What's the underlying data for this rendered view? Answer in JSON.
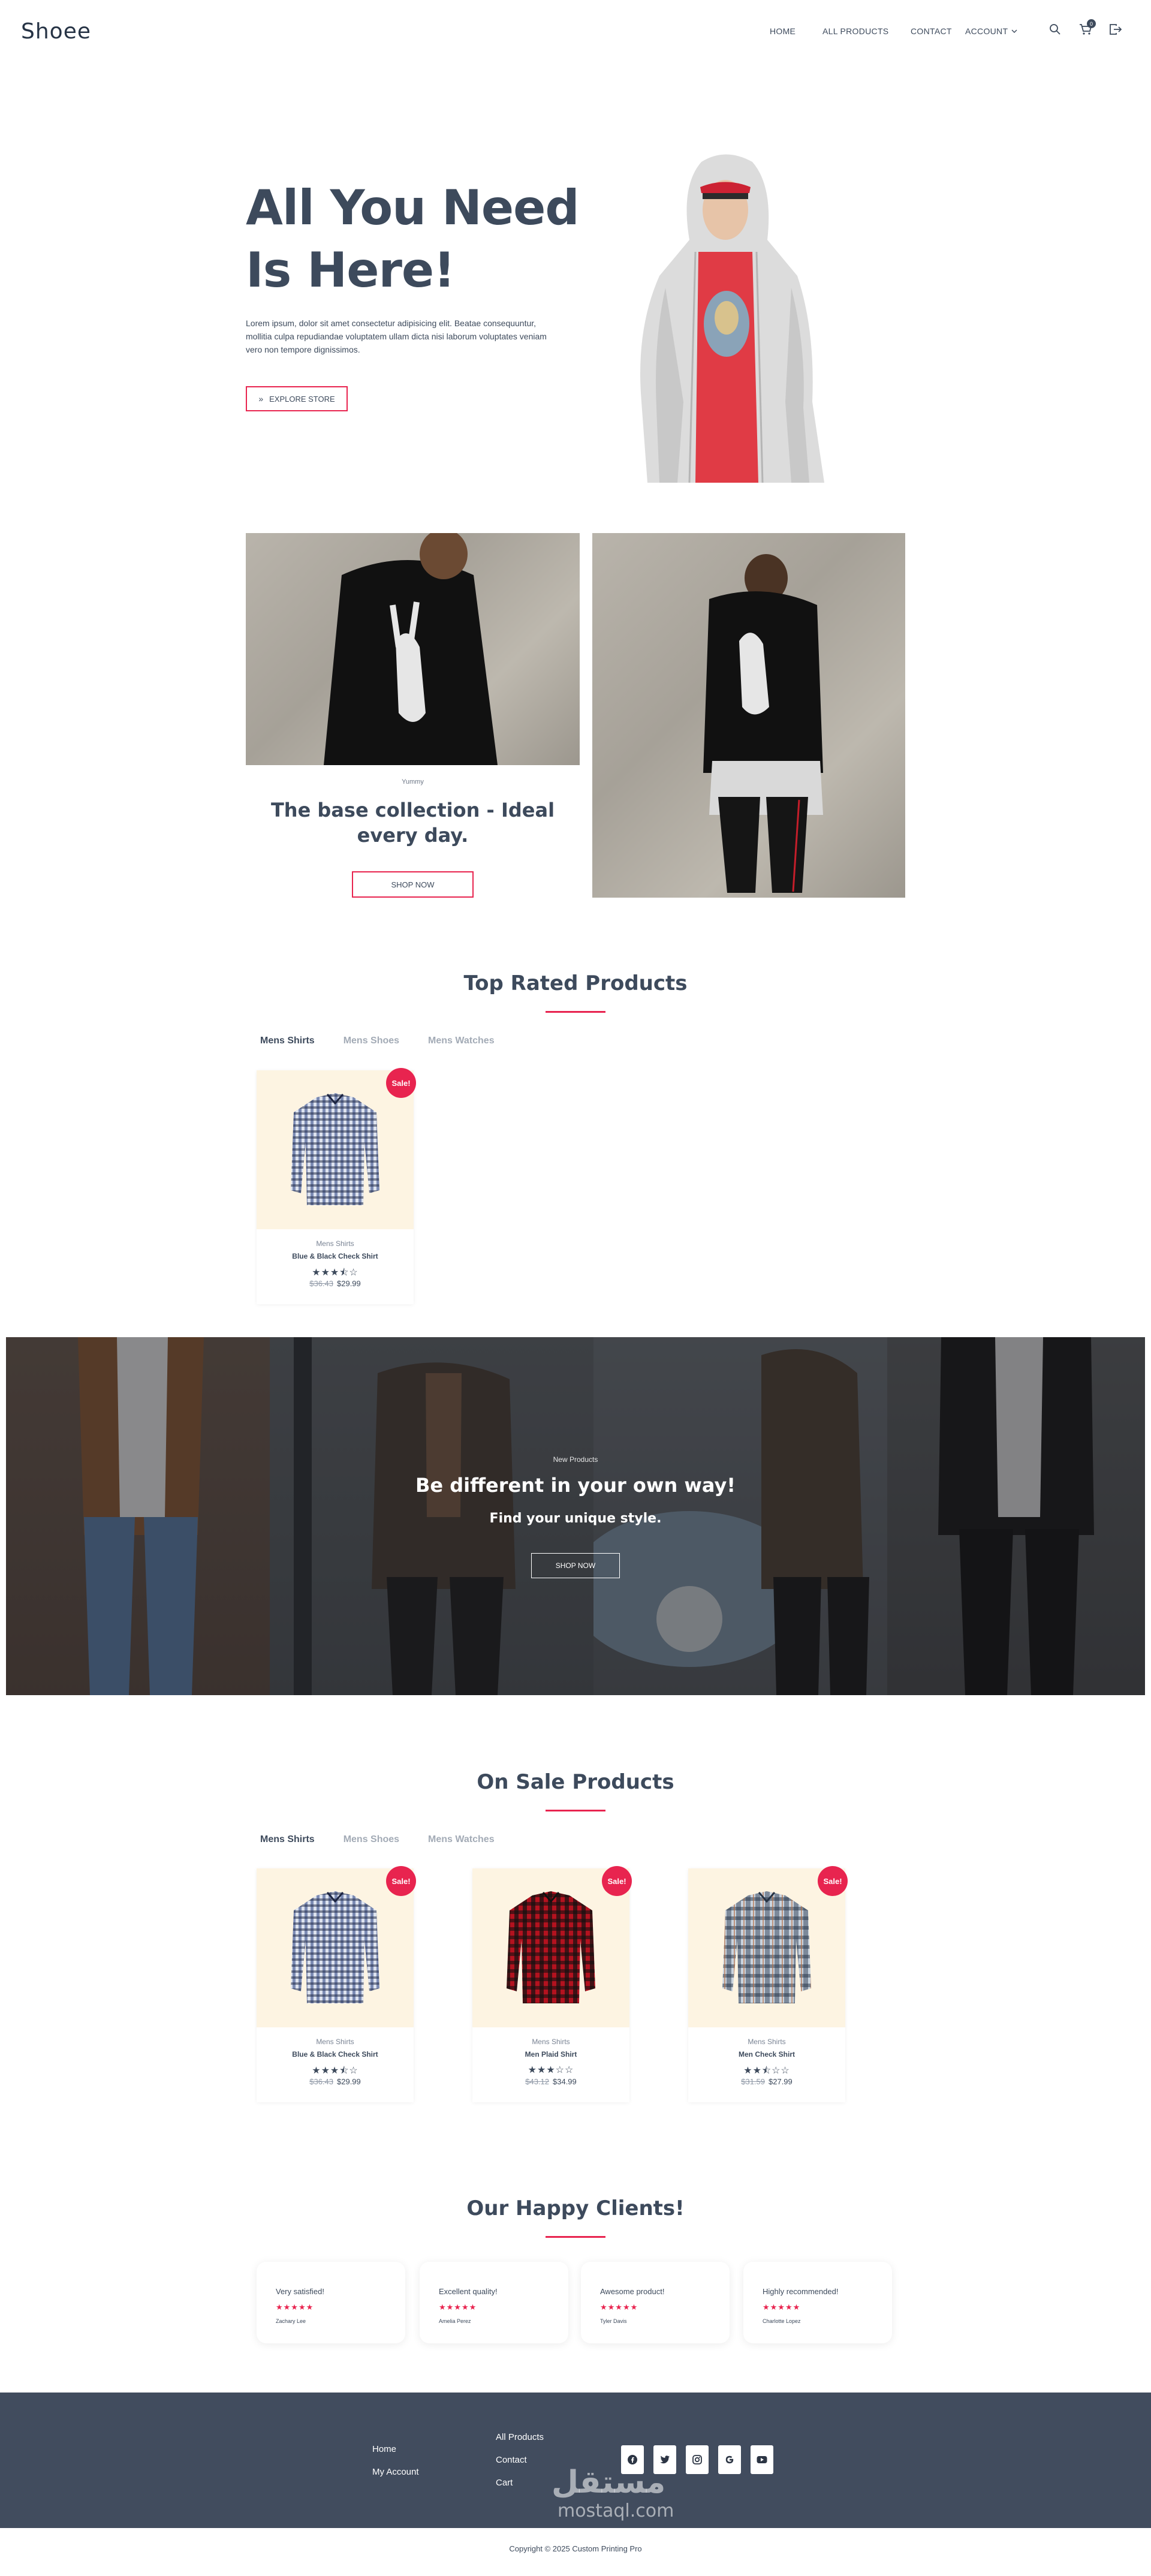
{
  "header": {
    "logo": "Shoee",
    "nav": [
      "HOME",
      "ALL PRODUCTS",
      "CONTACT",
      "ACCOUNT"
    ],
    "cart_count": "0",
    "icons": [
      "search-icon",
      "cart-icon",
      "logout-icon"
    ]
  },
  "hero": {
    "title": "All You Need Is Here!",
    "text": "Lorem ipsum, dolor sit amet consectetur adipisicing elit. Beatae consequuntur, mollitia culpa repudiandae voluptatem ullam dicta nisi laborum voluptates veniam vero non tempore dignissimos.",
    "button": "EXPLORE STORE"
  },
  "base_collection": {
    "tag": "Yummy",
    "title": "The base collection - Ideal every day.",
    "button": "SHOP NOW"
  },
  "top_rated": {
    "title": "Top Rated Products",
    "tabs": [
      "Mens Shirts",
      "Mens Shoes",
      "Mens Watches"
    ],
    "products": [
      {
        "badge": "Sale!",
        "category": "Mens Shirts",
        "name": "Blue & Black Check Shirt",
        "stars": "★★★⯪☆",
        "old_price": "$36.43",
        "price": "$29.99"
      }
    ]
  },
  "banner": {
    "tag": "New Products",
    "title": "Be different in your own way!",
    "subtitle": "Find your unique style.",
    "button": "SHOP NOW"
  },
  "on_sale": {
    "title": "On Sale Products",
    "tabs": [
      "Mens Shirts",
      "Mens Shoes",
      "Mens Watches"
    ],
    "products": [
      {
        "badge": "Sale!",
        "category": "Mens Shirts",
        "name": "Blue & Black Check Shirt",
        "stars": "★★★⯪☆",
        "old_price": "$36.43",
        "price": "$29.99"
      },
      {
        "badge": "Sale!",
        "category": "Mens Shirts",
        "name": "Men Plaid Shirt",
        "stars": "★★★☆☆",
        "old_price": "$43.12",
        "price": "$34.99"
      },
      {
        "badge": "Sale!",
        "category": "Mens Shirts",
        "name": "Men Check Shirt",
        "stars": "★★⯪☆☆",
        "old_price": "$31.59",
        "price": "$27.99"
      }
    ]
  },
  "clients": {
    "title": "Our Happy Clients!",
    "items": [
      {
        "text": "Very satisfied!",
        "stars": "★★★★★",
        "name": "Zachary Lee"
      },
      {
        "text": "Excellent quality!",
        "stars": "★★★★★",
        "name": "Amelia Perez"
      },
      {
        "text": "Awesome product!",
        "stars": "★★★★★",
        "name": "Tyler Davis"
      },
      {
        "text": "Highly recommended!",
        "stars": "★★★★★",
        "name": "Charlotte Lopez"
      }
    ]
  },
  "footer": {
    "col1": [
      "Home",
      "My Account"
    ],
    "col2": [
      "All Products",
      "Contact",
      "Cart"
    ],
    "social": [
      "facebook-icon",
      "twitter-icon",
      "instagram-icon",
      "google-icon",
      "youtube-icon"
    ],
    "watermark_arabic": "مستقل",
    "watermark_latin": "mostaql.com",
    "copyright": "Copyright © 2025 Custom Printing Pro"
  },
  "colors": {
    "accent": "#e8244f",
    "text": "#3d4a5c",
    "footer_bg": "#414c5e",
    "product_bg": "#fdf4e2"
  }
}
